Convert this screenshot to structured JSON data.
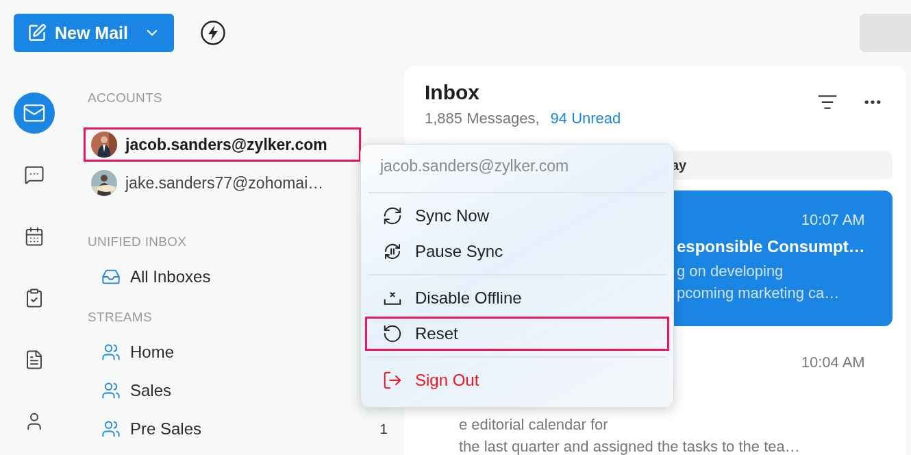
{
  "toolbar": {
    "new_mail": "New Mail"
  },
  "rail": [
    {
      "kind": "mail",
      "selected": true
    },
    {
      "kind": "chat",
      "selected": false
    },
    {
      "kind": "calendar",
      "selected": false
    },
    {
      "kind": "tasks",
      "selected": false
    },
    {
      "kind": "notes",
      "selected": false
    },
    {
      "kind": "contacts",
      "selected": false
    }
  ],
  "sidebar": {
    "accounts_title": "ACCOUNTS",
    "accounts": [
      {
        "email": "jacob.sanders@zylker.com",
        "highlighted": true
      },
      {
        "email": "jake.sanders77@zohomai…",
        "highlighted": false
      }
    ],
    "sections": [
      {
        "title": "UNIFIED INBOX",
        "items": [
          {
            "label": "All Inboxes",
            "kind": "inbox"
          }
        ]
      },
      {
        "title": "STREAMS",
        "items": [
          {
            "label": "Home",
            "kind": "group"
          },
          {
            "label": "Sales",
            "kind": "group"
          },
          {
            "label": "Pre Sales",
            "kind": "group",
            "count": "1"
          }
        ]
      }
    ]
  },
  "inbox": {
    "title": "Inbox",
    "messages_count": "1,885 Messages,",
    "unread": "94 Unread",
    "date_header": "ay",
    "messages": [
      {
        "selected": true,
        "time": "10:07 AM",
        "subject": "esponsible Consumpt…",
        "preview": [
          "g on developing",
          "pcoming marketing ca…"
        ]
      },
      {
        "selected": false,
        "time": "10:04 AM",
        "preview": [
          "e editorial calendar for",
          "the last quarter and assigned the tasks to the tea…"
        ]
      }
    ]
  },
  "context_menu": {
    "header": "jacob.sanders@zylker.com",
    "groups": [
      [
        {
          "label": "Sync Now",
          "kind": "sync",
          "danger": false,
          "highlighted": false
        },
        {
          "label": "Pause Sync",
          "kind": "pause",
          "danger": false,
          "highlighted": false
        }
      ],
      [
        {
          "label": "Disable Offline",
          "kind": "offline",
          "danger": false,
          "highlighted": false
        },
        {
          "label": "Reset",
          "kind": "reset",
          "danger": false,
          "highlighted": true
        }
      ],
      [
        {
          "label": "Sign Out",
          "kind": "signout",
          "danger": true,
          "highlighted": false
        }
      ]
    ]
  }
}
